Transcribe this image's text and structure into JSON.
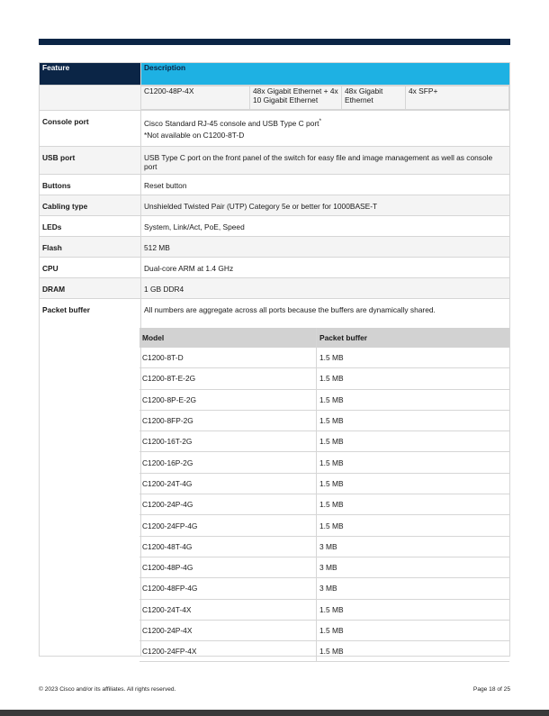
{
  "header": {
    "feature_label": "Feature",
    "description_label": "Description"
  },
  "model_row": {
    "model": "C1200-48P-4X",
    "col2": "48x Gigabit Ethernet + 4x 10 Gigabit Ethernet",
    "col3": "48x Gigabit Ethernet",
    "col4": "4x SFP+"
  },
  "rows": [
    {
      "feature": "Console port",
      "line1": "Cisco Standard RJ-45 console and USB Type C port",
      "sup": "*",
      "line2": "*Not available on C1200-8T-D"
    },
    {
      "feature": "USB port",
      "text": "USB Type C port on the front panel of the switch for easy file and image management as well as console port"
    },
    {
      "feature": "Buttons",
      "text": "Reset button"
    },
    {
      "feature": "Cabling type",
      "text": "Unshielded Twisted Pair (UTP) Category 5e or better for 1000BASE-T"
    },
    {
      "feature": "LEDs",
      "text": "System, Link/Act, PoE, Speed"
    },
    {
      "feature": "Flash",
      "text": "512 MB"
    },
    {
      "feature": "CPU",
      "text": "Dual-core ARM at 1.4 GHz"
    },
    {
      "feature": "DRAM",
      "text": "1 GB DDR4"
    },
    {
      "feature": "Packet buffer",
      "text": "All numbers are aggregate across all ports because the buffers are dynamically shared."
    }
  ],
  "buffer_table": {
    "headers": [
      "Model",
      "Packet buffer"
    ],
    "rows": [
      [
        "C1200-8T-D",
        "1.5 MB"
      ],
      [
        "C1200-8T-E-2G",
        "1.5 MB"
      ],
      [
        "C1200-8P-E-2G",
        "1.5 MB"
      ],
      [
        "C1200-8FP-2G",
        "1.5 MB"
      ],
      [
        "C1200-16T-2G",
        "1.5 MB"
      ],
      [
        "C1200-16P-2G",
        "1.5 MB"
      ],
      [
        "C1200-24T-4G",
        "1.5 MB"
      ],
      [
        "C1200-24P-4G",
        "1.5 MB"
      ],
      [
        "C1200-24FP-4G",
        "1.5 MB"
      ],
      [
        "C1200-48T-4G",
        "3 MB"
      ],
      [
        "C1200-48P-4G",
        "3 MB"
      ],
      [
        "C1200-48FP-4G",
        "3 MB"
      ],
      [
        "C1200-24T-4X",
        "1.5 MB"
      ],
      [
        "C1200-24P-4X",
        "1.5 MB"
      ],
      [
        "C1200-24FP-4X",
        "1.5 MB"
      ]
    ]
  },
  "footer": {
    "copyright": "© 2023 Cisco and/or its affiliates. All rights reserved.",
    "page": "Page 18 of 25"
  }
}
